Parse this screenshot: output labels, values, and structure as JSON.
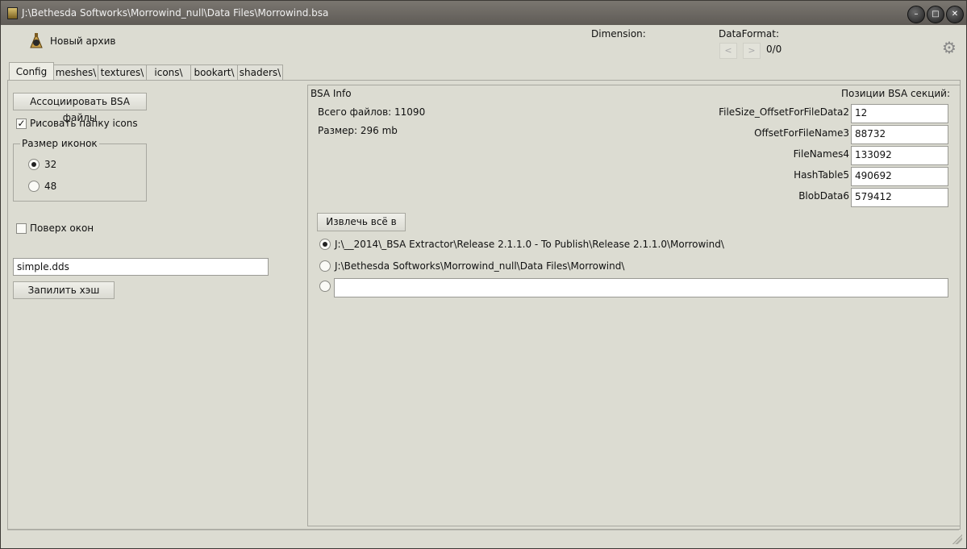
{
  "window": {
    "title": "J:\\Bethesda Softworks\\Morrowind_null\\Data Files\\Morrowind.bsa",
    "controls": [
      "minimize",
      "maximize",
      "close"
    ]
  },
  "toolbar": {
    "new_archive_label": "Новый архив",
    "dimension_label": "Dimension:",
    "dataformat_label": "DataFormat:",
    "prev": "<",
    "next": ">",
    "page_count": "0/0",
    "settings_icon": "gear-icon"
  },
  "tabs": [
    {
      "label": "Config",
      "active": true
    },
    {
      "label": "meshes\\"
    },
    {
      "label": "textures\\"
    },
    {
      "label": "icons\\"
    },
    {
      "label": "bookart\\"
    },
    {
      "label": "shaders\\"
    }
  ],
  "config": {
    "associate_button": "Ассоциировать BSA файлы",
    "draw_icons_folder": {
      "label": "Рисовать папку icons",
      "checked": true
    },
    "icon_size_group": {
      "title": "Размер иконок",
      "options": [
        {
          "label": "32",
          "checked": true
        },
        {
          "label": "48",
          "checked": false
        }
      ]
    },
    "on_top": {
      "label": "Поверх окон",
      "checked": false
    },
    "hash_file_value": "simple.dds",
    "hash_button": "Запилить хэш"
  },
  "bsa_info": {
    "title": "BSA Info",
    "total_files": "Всего файлов: 11090",
    "size": "Размер: 296 mb",
    "sections_title": "Позиции BSA секций:",
    "fields": [
      {
        "label": "FileSize_OffsetForFileData2",
        "value": "12"
      },
      {
        "label": "OffsetForFileName3",
        "value": "88732"
      },
      {
        "label": "FileNames4",
        "value": "133092"
      },
      {
        "label": "HashTable5",
        "value": "490692"
      },
      {
        "label": "BlobData6",
        "value": "579412"
      }
    ],
    "extract_all_button": "Извлечь всё в",
    "extract_paths": [
      {
        "label": "J:\\__2014\\_BSA Extractor\\Release 2.1.1.0 - To Publish\\Release 2.1.1.0\\Morrowind\\",
        "checked": true
      },
      {
        "label": "J:\\Bethesda Softworks\\Morrowind_null\\Data Files\\Morrowind\\",
        "checked": false
      },
      {
        "label": "",
        "checked": false
      }
    ]
  }
}
